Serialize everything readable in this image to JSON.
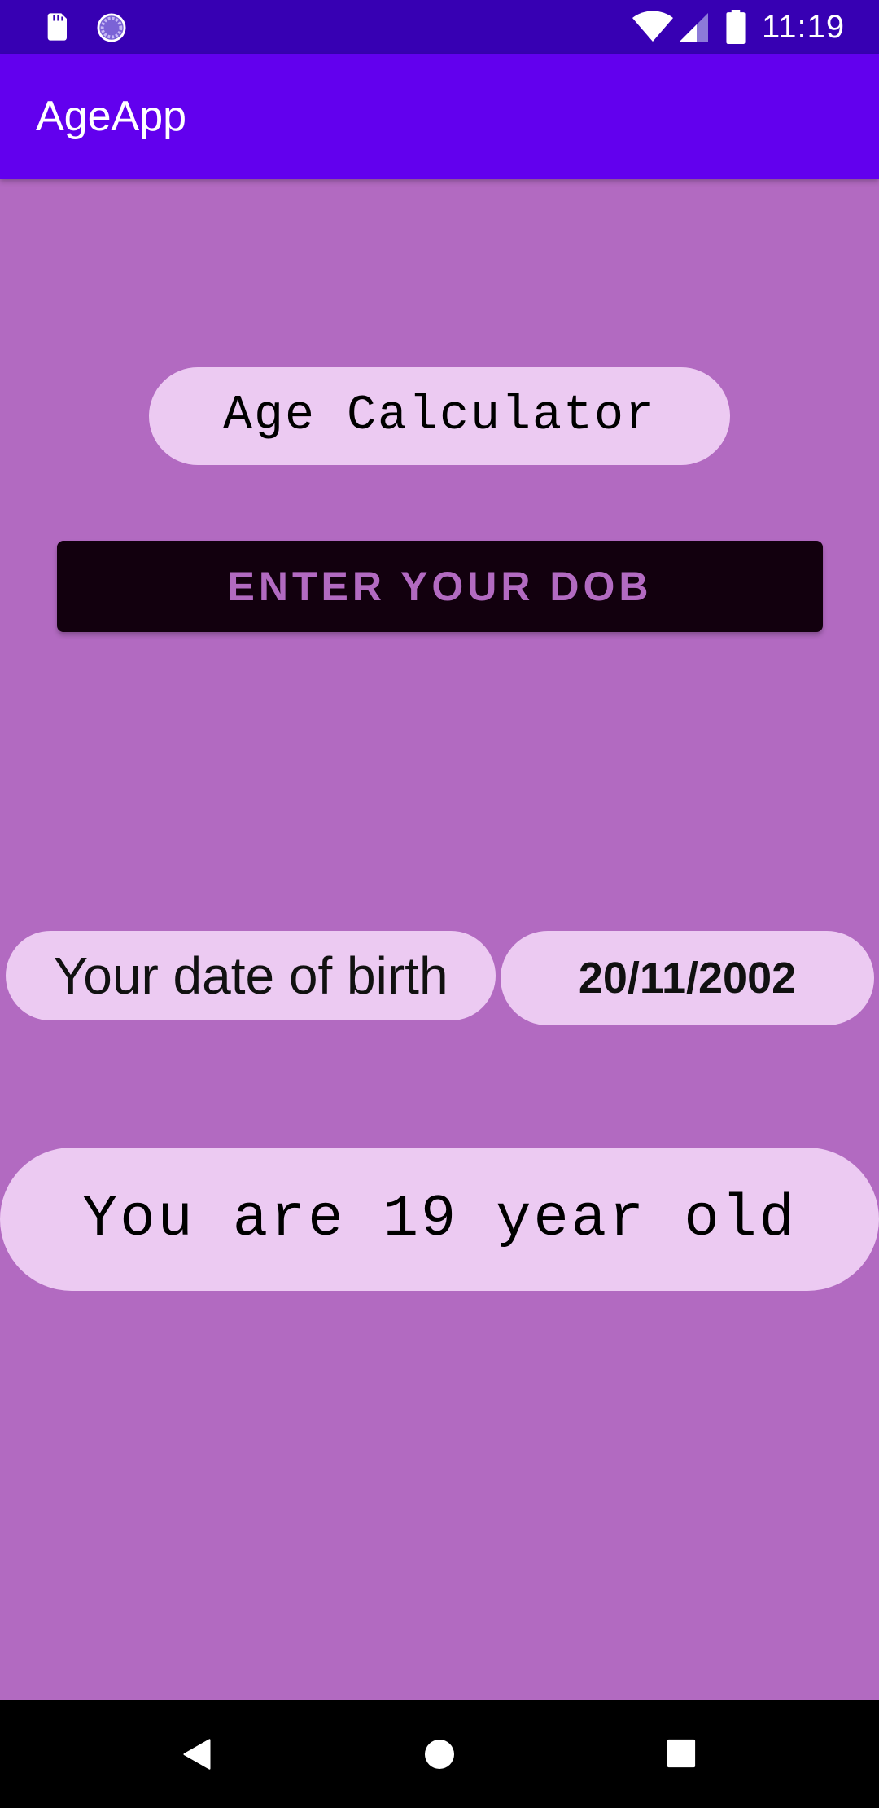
{
  "status_bar": {
    "time": "11:19",
    "icons": [
      "sd-card-icon",
      "sync-icon",
      "wifi-icon",
      "cell-signal-icon",
      "battery-icon"
    ]
  },
  "app_bar": {
    "title": "AgeApp",
    "color": "#6200EE"
  },
  "main": {
    "background": "#B26AC1",
    "headline": "Age Calculator",
    "enter_dob_button": "ENTER YOUR DOB",
    "dob_label": "Your date of birth",
    "dob_value": "20/11/2002",
    "age_result": "You are 19 year old"
  },
  "nav_bar": {
    "icons": [
      "back-icon",
      "home-icon",
      "recents-icon"
    ]
  },
  "colors": {
    "status_bar": "#3700B3",
    "pill_background": "#ECCAF2",
    "button_background": "#12000E",
    "button_text": "#B26AC1"
  }
}
